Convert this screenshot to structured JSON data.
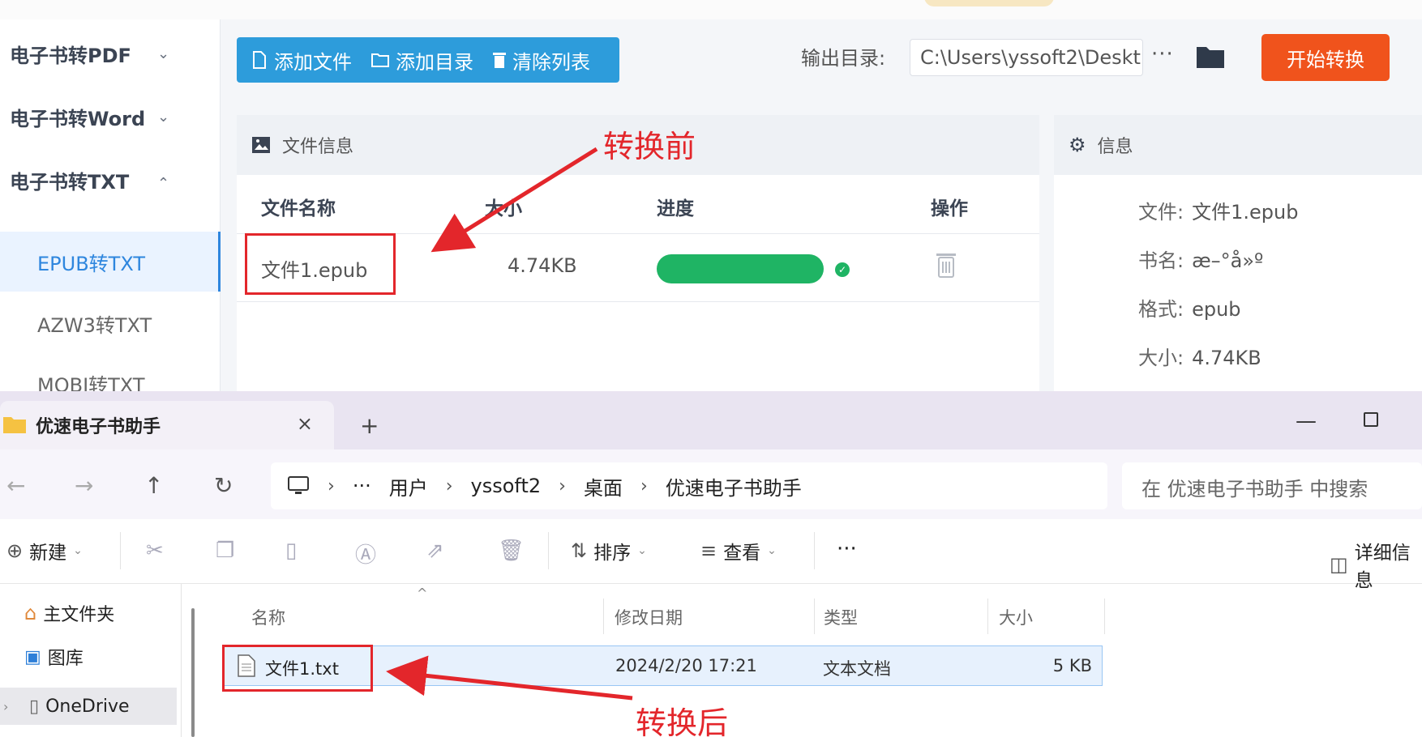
{
  "converter": {
    "sidebar": {
      "groups": [
        {
          "label": "电子书转PDF",
          "chevron": "v"
        },
        {
          "label": "电子书转Word",
          "chevron": "v"
        },
        {
          "label": "电子书转TXT",
          "chevron": "^"
        }
      ],
      "subitems": [
        "EPUB转TXT",
        "AZW3转TXT",
        "MOBI转TXT"
      ],
      "active_subitem": "EPUB转TXT"
    },
    "toolbar": {
      "add_file": "添加文件",
      "add_dir": "添加目录",
      "clear_list": "清除列表"
    },
    "output": {
      "label": "输出目录:",
      "path": "C:\\Users\\yssoft2\\Deskt",
      "more": "···"
    },
    "start_button": "开始转换",
    "file_panel": {
      "title": "文件信息",
      "columns": [
        "文件名称",
        "大小",
        "进度",
        "操作"
      ],
      "rows": [
        {
          "name": "文件1.epub",
          "size": "4.74KB",
          "progress": 1.0,
          "status": "done"
        }
      ]
    },
    "info_panel": {
      "title": "信息",
      "rows": [
        {
          "key": "文件:",
          "value": "文件1.epub"
        },
        {
          "key": "书名:",
          "value": "æ–°å»º"
        },
        {
          "key": "格式:",
          "value": "epub"
        },
        {
          "key": "大小:",
          "value": "4.74KB"
        }
      ]
    }
  },
  "annotations": {
    "before": "转换前",
    "after": "转换后"
  },
  "explorer": {
    "tab_title": "优速电子书助手",
    "tab_close": "×",
    "new_tab": "+",
    "breadcrumb": [
      "用户",
      "yssoft2",
      "桌面",
      "优速电子书助手"
    ],
    "breadcrumb_more": "···",
    "search_placeholder": "在 优速电子书助手 中搜索",
    "commands": {
      "new": "新建",
      "sort": "排序",
      "view": "查看",
      "more": "···",
      "details": "详细信息"
    },
    "nav": [
      "主文件夹",
      "图库",
      "OneDrive"
    ],
    "columns": [
      "名称",
      "修改日期",
      "类型",
      "大小"
    ],
    "files": [
      {
        "name": "文件1.txt",
        "modified": "2024/2/20 17:21",
        "type": "文本文档",
        "size": "5 KB"
      }
    ]
  },
  "colors": {
    "accent_blue": "#2d9cdb",
    "start_orange": "#f0531c",
    "progress_green": "#1fb464",
    "annotation_red": "#e3262b"
  }
}
